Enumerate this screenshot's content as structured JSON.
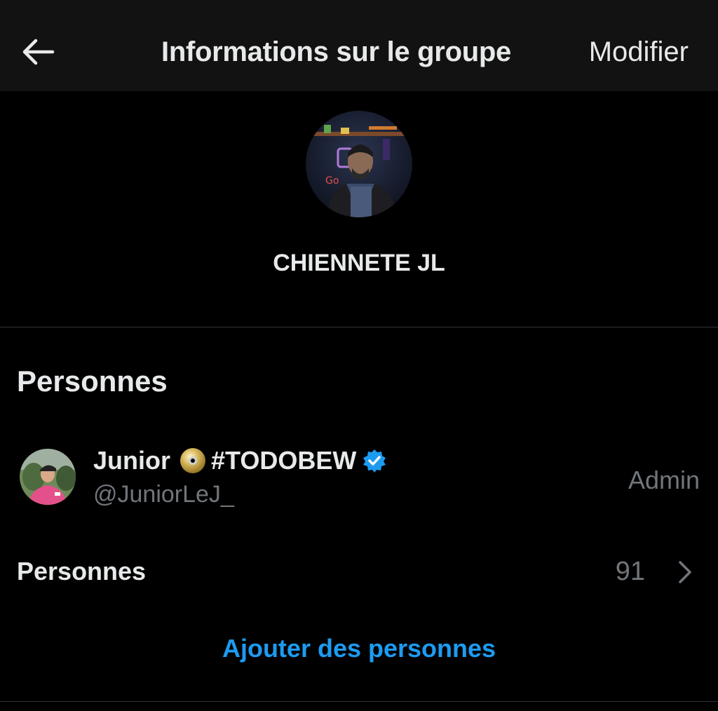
{
  "header": {
    "title": "Informations sur le groupe",
    "edit_label": "Modifier",
    "back_icon": "arrow-left-icon"
  },
  "group": {
    "name": "CHIENNETE JL",
    "avatar": "group-avatar-photo"
  },
  "people_section": {
    "title": "Personnes",
    "members": [
      {
        "name": "Junior",
        "emoji_icon": "dvd-disc-icon",
        "hashtag": "#TODOBEW",
        "verified_icon": "verified-badge-icon",
        "handle": "@JuniorLeJ_",
        "role": "Admin"
      }
    ],
    "all_people_label": "Personnes",
    "count": "91",
    "add_people_label": "Ajouter des personnes"
  },
  "colors": {
    "background": "#000000",
    "header_bg": "#121212",
    "text_primary": "#e7e9ea",
    "text_secondary": "#71767b",
    "accent": "#1d9bf0",
    "divider": "#2f3336"
  }
}
